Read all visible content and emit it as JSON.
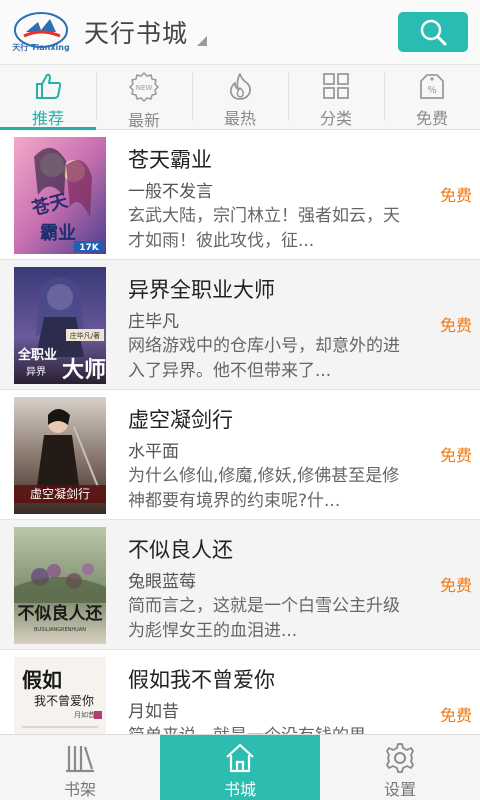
{
  "header": {
    "app_title": "天行书城",
    "logo_text": "天行 Tianxing",
    "accent_color": "#28bdb0"
  },
  "tabs": [
    {
      "label": "推荐",
      "icon": "thumbs-up-icon",
      "active": true
    },
    {
      "label": "最新",
      "icon": "new-badge-icon",
      "active": false
    },
    {
      "label": "最热",
      "icon": "flame-icon",
      "active": false
    },
    {
      "label": "分类",
      "icon": "grid-icon",
      "active": false
    },
    {
      "label": "免费",
      "icon": "percent-tag-icon",
      "active": false
    }
  ],
  "books": [
    {
      "title": "苍天霸业",
      "author": "一般不发言",
      "description": "玄武大陆，宗门林立！强者如云，天才如雨！彼此攻伐，征...",
      "price": "免费",
      "cover_text": "苍天霸业",
      "cover_badge": "17K"
    },
    {
      "title": "异界全职业大师",
      "author": "庄毕凡",
      "description": "网络游戏中的仓库小号，却意外的进入了异界。他不但带来了...",
      "price": "免费",
      "cover_text": "全职业大师",
      "cover_subtext": "异界"
    },
    {
      "title": "虚空凝剑行",
      "author": "水平面",
      "description": "为什么修仙,修魔,修妖,修佛甚至是修神都要有境界的约束呢?什...",
      "price": "免费",
      "cover_text": "虚空凝剑行"
    },
    {
      "title": "不似良人还",
      "author": "兔眼蓝莓",
      "description": "简而言之，这就是一个白雪公主升级为彪悍女王的血泪进...",
      "price": "免费",
      "cover_text": "不似良人还"
    },
    {
      "title": "假如我不曾爱你",
      "author": "月如昔",
      "description": "简单来说，就是一个没有钱的男...",
      "price": "免费",
      "cover_text": "假如我不曾爱你"
    }
  ],
  "bottom_nav": [
    {
      "label": "书架",
      "icon": "bookshelf-icon",
      "active": false
    },
    {
      "label": "书城",
      "icon": "home-icon",
      "active": true
    },
    {
      "label": "设置",
      "icon": "gear-icon",
      "active": false
    }
  ],
  "colors": {
    "accent": "#22b3a6",
    "price": "#f07a10",
    "nav_active": "#2cbcb0"
  }
}
